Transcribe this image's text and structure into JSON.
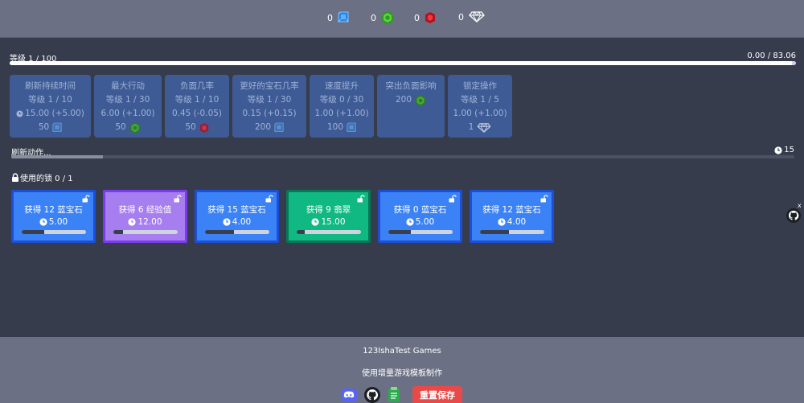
{
  "resources": [
    {
      "value": "0",
      "icon": "sapphire-icon",
      "color": "#3a9cf0"
    },
    {
      "value": "0",
      "icon": "emerald-icon",
      "color": "#38b52a"
    },
    {
      "value": "0",
      "icon": "ruby-icon",
      "color": "#d01d2a"
    },
    {
      "value": "0",
      "icon": "diamond-icon",
      "color": "#ffffff"
    }
  ],
  "level": {
    "label": "等级 1 / 100",
    "progress_text": "0.00 / 83.06",
    "progress_fraction": 0.995
  },
  "upgrades": [
    {
      "name": "刷新持续时间",
      "level": "等级 1 / 10",
      "value": "15.00 (+5.00)",
      "cost": "50",
      "cost_icon": "sapphire-icon"
    },
    {
      "name": "最大行动",
      "level": "等级 1 / 30",
      "value": "6.00 (+1.00)",
      "cost": "50",
      "cost_icon": "emerald-icon"
    },
    {
      "name": "负面几率",
      "level": "等级 1 / 10",
      "value": "0.45 (-0.05)",
      "cost": "50",
      "cost_icon": "ruby-icon"
    },
    {
      "name": "更好的宝石几率",
      "level": "等级 1 / 30",
      "value": "0.15 (+0.15)",
      "cost": "200",
      "cost_icon": "sapphire-icon"
    },
    {
      "name": "速度提升",
      "level": "等级 0 / 30",
      "value": "1.00 (+1.00)",
      "cost": "100",
      "cost_icon": "sapphire-icon"
    },
    {
      "name": "突出负面影响",
      "cost": "200",
      "cost_icon": "emerald-icon"
    },
    {
      "name": "锁定操作",
      "level": "等级 1 / 5",
      "value": "1.00 (+1.00)",
      "cost": "1",
      "cost_icon": "diamond-icon"
    }
  ],
  "refresh": {
    "label": "刷新动作...",
    "time": "15",
    "progress_fraction": 0.117
  },
  "lock": {
    "label": "使用的锁 0 / 1"
  },
  "actions": [
    {
      "title": "获得 12 蓝宝石",
      "time": "5.00",
      "progress_fraction": 0.35,
      "bg": "#3b82f6",
      "border": "#1d4ed8"
    },
    {
      "title": "获得 6 经验值",
      "time": "12.00",
      "progress_fraction": 0.15,
      "bg": "#a67ef0",
      "border": "#7c3aed"
    },
    {
      "title": "获得 15 蓝宝石",
      "time": "4.00",
      "progress_fraction": 0.45,
      "bg": "#3b82f6",
      "border": "#1d4ed8"
    },
    {
      "title": "获得 9 翡翠",
      "time": "15.00",
      "progress_fraction": 0.12,
      "bg": "#10b981",
      "border": "#047857"
    },
    {
      "title": "获得 0 蓝宝石",
      "time": "5.00",
      "progress_fraction": 0.35,
      "bg": "#3b82f6",
      "border": "#1d4ed8"
    },
    {
      "title": "获得 12 蓝宝石",
      "time": "4.00",
      "progress_fraction": 0.45,
      "bg": "#3b82f6",
      "border": "#1d4ed8"
    }
  ],
  "side": {
    "close": "x"
  },
  "footer": {
    "credit": "123IshaTest Games",
    "made_with": "使用增量游戏模板制作",
    "reset_label": "重置保存"
  }
}
